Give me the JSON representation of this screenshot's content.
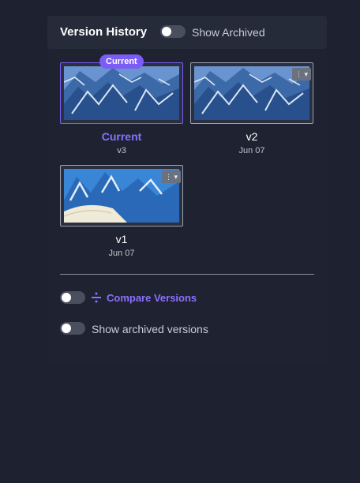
{
  "header": {
    "title": "Version History",
    "toggle_label": "Show Archived",
    "toggle_on": false
  },
  "versions": [
    {
      "name": "Current",
      "sub": "v3",
      "badge": "Current",
      "selected": true,
      "image": "mountain-snow-thumbnail"
    },
    {
      "name": "v2",
      "sub": "Jun 07",
      "selected": false,
      "image": "mountain-snow-thumbnail",
      "menu_icon": "more-dropdown-icon"
    },
    {
      "name": "v1",
      "sub": "Jun 07",
      "selected": false,
      "image": "mountain-snow-thumbnail",
      "menu_icon": "more-dropdown-icon"
    }
  ],
  "compare": {
    "label": "Compare Versions",
    "icon": "compare-icon",
    "toggle_on": false
  },
  "archived": {
    "label": "Show archived versions",
    "toggle_on": false
  },
  "colors": {
    "accent": "#7b5cf5",
    "background": "#1e2230",
    "panel": "#262b3a"
  }
}
